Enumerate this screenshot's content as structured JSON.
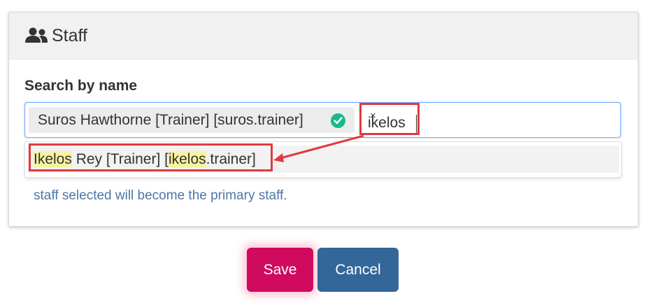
{
  "panel": {
    "icon": "users-icon",
    "title": "Staff"
  },
  "field": {
    "label": "Search by name"
  },
  "selected_tag": {
    "label": "Suros Hawthorne [Trainer] [suros.trainer]",
    "status_icon": "check-circle-icon",
    "remove_symbol": "×"
  },
  "search": {
    "typed": "ikelos"
  },
  "dropdown": {
    "option": {
      "part1": "Ikelos",
      "part2": " Rey [Trainer] [",
      "part3": "ikelos",
      "part4": ".trainer]"
    }
  },
  "help_text": "staff selected will become the primary staff.",
  "buttons": {
    "save": "Save",
    "cancel": "Cancel"
  },
  "colors": {
    "save": "#cf0a5f",
    "cancel": "#336699",
    "annotation": "#e03a3e",
    "match_highlight": "#f7f3a1",
    "check": "#18b98a"
  }
}
